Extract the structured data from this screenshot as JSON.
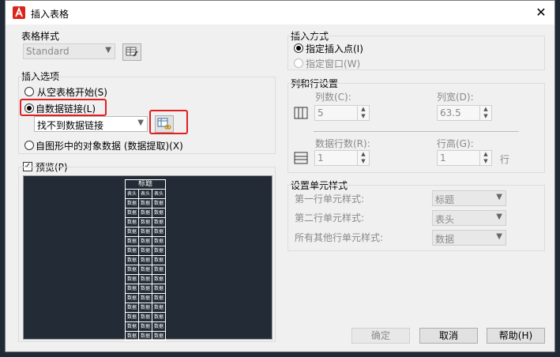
{
  "dialog": {
    "title": "插入表格",
    "close_glyph": "✕",
    "table_style": {
      "section": "表格样式",
      "selected": "Standard"
    },
    "insert_options": {
      "section": "插入选项",
      "option_empty": "从空表格开始(S)",
      "option_link": "自数据链接(L)",
      "link_combo_value": "找不到数据链接",
      "option_extract": "自图形中的对象数据 (数据提取)(X)"
    },
    "preview": {
      "label": "预览(P)",
      "checked": true,
      "table_title": "标题",
      "header_cells": [
        "表头",
        "表头",
        "表头"
      ],
      "data_cell": "数据",
      "row_count": 15
    },
    "insert_method": {
      "section": "插入方式",
      "specify_point": "指定插入点(I)",
      "specify_window": "指定窗口(W)"
    },
    "rows_cols": {
      "section": "列和行设置",
      "columns_label": "列数(C):",
      "columns_value": "5",
      "col_width_label": "列宽(D):",
      "col_width_value": "63.5",
      "data_rows_label": "数据行数(R):",
      "data_rows_value": "1",
      "row_height_label": "行高(G):",
      "row_height_value": "1",
      "row_unit": "行"
    },
    "cell_styles": {
      "section": "设置单元样式",
      "first_row_label": "第一行单元样式:",
      "first_row_value": "标题",
      "second_row_label": "第二行单元样式:",
      "second_row_value": "表头",
      "other_rows_label": "所有其他行单元样式:",
      "other_rows_value": "数据"
    },
    "buttons": {
      "ok": "确定",
      "cancel": "取消",
      "help": "帮助(H)"
    }
  }
}
